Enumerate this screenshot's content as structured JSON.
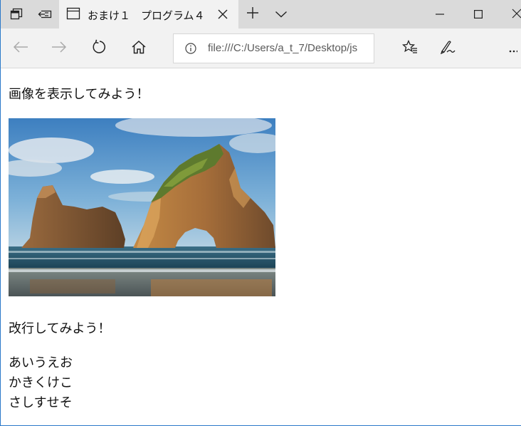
{
  "tab": {
    "title": "おまけ１　プログラム４"
  },
  "address_bar": {
    "url": "file:///C:/Users/a_t_7/Desktop/js"
  },
  "icons": {
    "tab_set_aside": "tabs-aside-icon",
    "tab_back": "show-tabs-icon",
    "tab_page": "page-icon",
    "close_tab": "close-icon",
    "new_tab": "plus-icon",
    "tab_preview": "chevron-down-icon",
    "minimize": "minimize-icon",
    "maximize": "maximize-icon",
    "close_window": "close-icon",
    "back": "back-arrow-icon",
    "forward": "forward-arrow-icon",
    "refresh": "refresh-icon",
    "home": "home-icon",
    "info": "info-icon",
    "favorites": "favorites-icon",
    "notes": "pen-icon",
    "more": "more-icon"
  },
  "content": {
    "heading": "画像を表示してみよう！",
    "image_alt": "beach rock arch photo",
    "line_break_text": "改行してみよう！",
    "lines": [
      "あいうえお",
      "かきくけこ",
      "さしすせそ"
    ]
  },
  "colors": {
    "tab_bar": "#dadada",
    "active_tab": "#f2f2f2",
    "window_border": "#2b79c9"
  }
}
